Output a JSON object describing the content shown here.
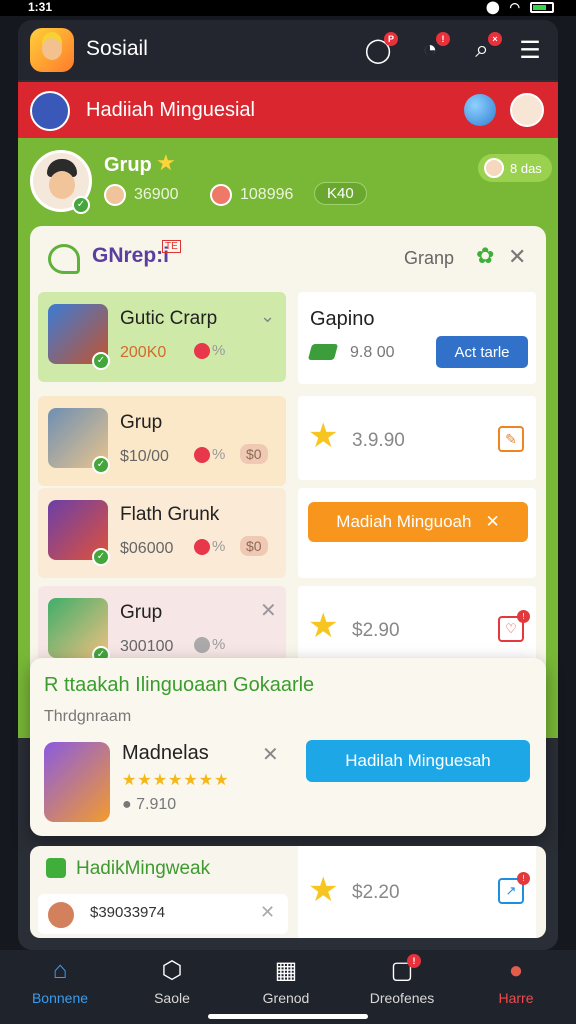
{
  "status_bar": {
    "time": "1:31",
    "carrier_icons": "G N"
  },
  "header": {
    "title": "Sosiail",
    "logo_icon": "app-logo-icon"
  },
  "banner": {
    "title": "Hadiiah Minguesial"
  },
  "profile": {
    "name": "Grup",
    "stat1": "36900",
    "stat2": "108996",
    "pill": "K40",
    "chip": "8 das"
  },
  "card": {
    "title": "GNrep:i",
    "tag": "TE",
    "subtitle": "Granp",
    "groups": [
      {
        "name": "Gutic Crarp",
        "value": "200K0",
        "pct": "%",
        "chip": ""
      },
      {
        "name": "Grup",
        "value": "$10/00",
        "pct": "%",
        "chip": "$0"
      },
      {
        "name": "Flath Grunk",
        "value": "$06000",
        "pct": "%",
        "chip": "$0"
      },
      {
        "name": "Grup",
        "value": "300100",
        "pct": "%",
        "chip": ""
      }
    ],
    "right": {
      "title": "Gapino",
      "value": "9.8 00",
      "button": "Act tarle",
      "price1": "3.9.90",
      "orange_button": "Madiah Minguoah",
      "price2": "$2.90"
    }
  },
  "popup": {
    "title": "R ttaakah Ilinguoaan Gokaarle",
    "subtitle": "Thrdgnraam",
    "item_name": "Madnelas",
    "stars": "★★★★★★★",
    "rating": "7.910",
    "button": "Hadilah Minguesah"
  },
  "bottom_card": {
    "title": "HadikMingweak",
    "row_text": "$39033974",
    "price": "$2.20"
  },
  "nav": [
    {
      "label": "Bonnene",
      "icon": "home-icon"
    },
    {
      "label": "Saole",
      "icon": "shield-icon"
    },
    {
      "label": "Grenod",
      "icon": "grid-icon"
    },
    {
      "label": "Dreofenes",
      "icon": "chat-icon"
    },
    {
      "label": "Harre",
      "icon": "profile-icon"
    }
  ]
}
